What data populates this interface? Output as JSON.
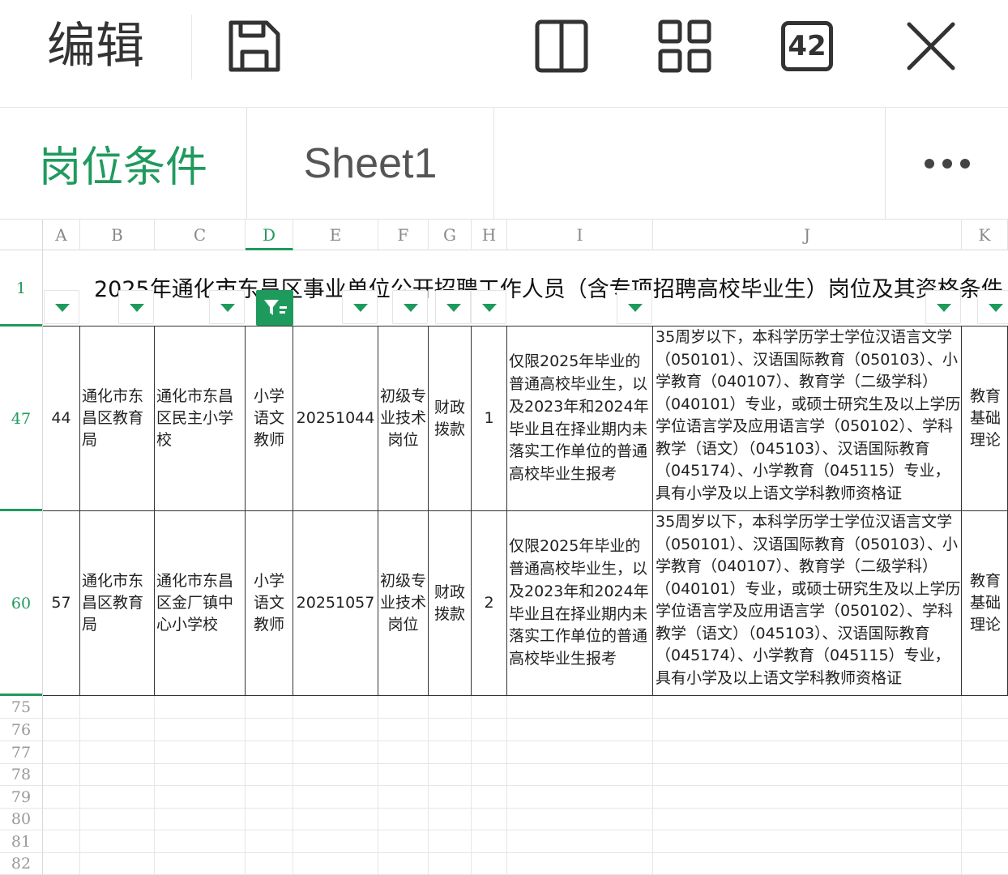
{
  "toolbar": {
    "edit_label": "编辑",
    "badge_label": "42",
    "icons": [
      "save-icon",
      "split-view-icon",
      "grid-view-icon",
      "tab-count-icon",
      "close-icon"
    ]
  },
  "tabs": [
    {
      "label": "岗位条件",
      "active": true
    },
    {
      "label": "Sheet1",
      "active": false
    }
  ],
  "columns": [
    "A",
    "B",
    "C",
    "D",
    "E",
    "F",
    "G",
    "H",
    "I",
    "J",
    "K"
  ],
  "active_column": "D",
  "title_row": {
    "row_number": "1",
    "text": "2025年通化市东昌区事业单位公开招聘工作人员（含专项招聘高校毕业生）岗位及其资格条件"
  },
  "rows": [
    {
      "row_number": "47",
      "A": "44",
      "B": "通化市东昌区教育局",
      "C": "通化市东昌区民主小学校",
      "D": "小学语文教师",
      "E": "20251044",
      "F": "初级专业技术岗位",
      "G": "财政拨款",
      "H": "1",
      "I": "仅限2025年毕业的普通高校毕业生，以及2023年和2024年毕业且在择业期内未落实工作单位的普通高校毕业生报考",
      "J": "35周岁以下，本科学历学士学位汉语言文学（050101）、汉语国际教育（050103）、小学教育（040107）、教育学（二级学科）（040101）专业，或硕士研究生及以上学历学位语言学及应用语言学（050102）、学科教学（语文）（045103）、汉语国际教育（045174）、小学教育（045115）专业，具有小学及以上语文学科教师资格证",
      "K": "教育基础理论"
    },
    {
      "row_number": "60",
      "A": "57",
      "B": "通化市东昌区教育局",
      "C": "通化市东昌区金厂镇中心小学校",
      "D": "小学语文教师",
      "E": "20251057",
      "F": "初级专业技术岗位",
      "G": "财政拨款",
      "H": "2",
      "I": "仅限2025年毕业的普通高校毕业生，以及2023年和2024年毕业且在择业期内未落实工作单位的普通高校毕业生报考",
      "J": "35周岁以下，本科学历学士学位汉语言文学（050101）、汉语国际教育（050103）、小学教育（040107）、教育学（二级学科）（040101）专业，或硕士研究生及以上学历学位语言学及应用语言学（050102）、学科教学（语文）（045103）、汉语国际教育（045174）、小学教育（045115）专业，具有小学及以上语文学科教师资格证",
      "K": "教育基础理论"
    }
  ],
  "empty_rows": [
    "75",
    "76",
    "77",
    "78",
    "79",
    "80",
    "81",
    "82"
  ]
}
